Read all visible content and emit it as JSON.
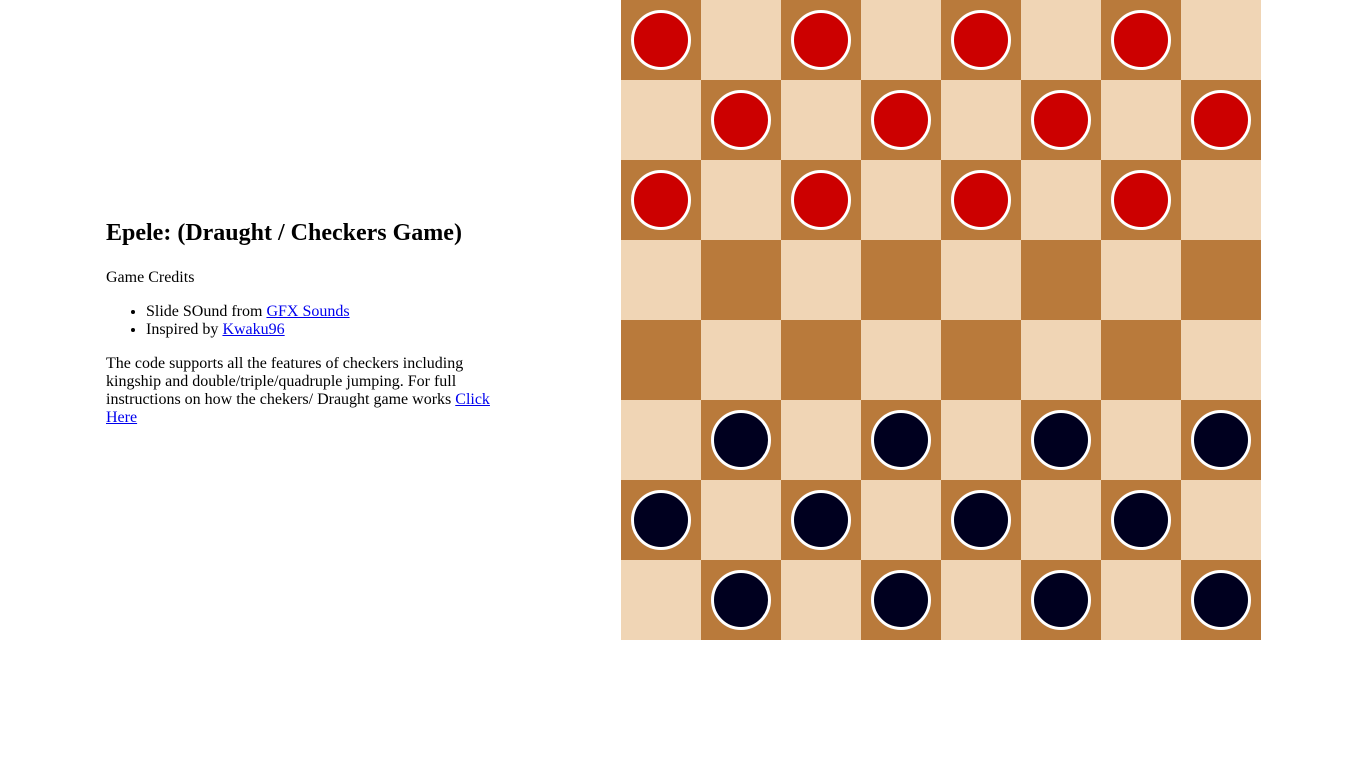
{
  "title": "Epele: (Draught / Checkers Game)",
  "credits": {
    "heading": "Game Credits",
    "items": [
      {
        "prefix": "Slide SOund from ",
        "link": "GFX Sounds"
      },
      {
        "prefix": "Inspired by ",
        "link": "Kwaku96"
      }
    ]
  },
  "description": {
    "text": "The code supports all the features of checkers including kingship and double/triple/quadruple jumping. For full instructions on how the chekers/ Draught game works ",
    "link": "Click Here"
  },
  "board": {
    "size": 8,
    "colors": {
      "light_square": "#f0d5b5",
      "dark_square": "#b97a3b",
      "red_piece": "#cc0000",
      "black_piece": "#00001f",
      "piece_border": "#ffffff"
    },
    "rows": [
      "r.r.r.r.",
      ".r.r.r.r",
      "r.r.r.r.",
      "........",
      "........",
      ".b.b.b.b",
      "b.b.b.b.",
      ".b.b.b.b"
    ]
  }
}
